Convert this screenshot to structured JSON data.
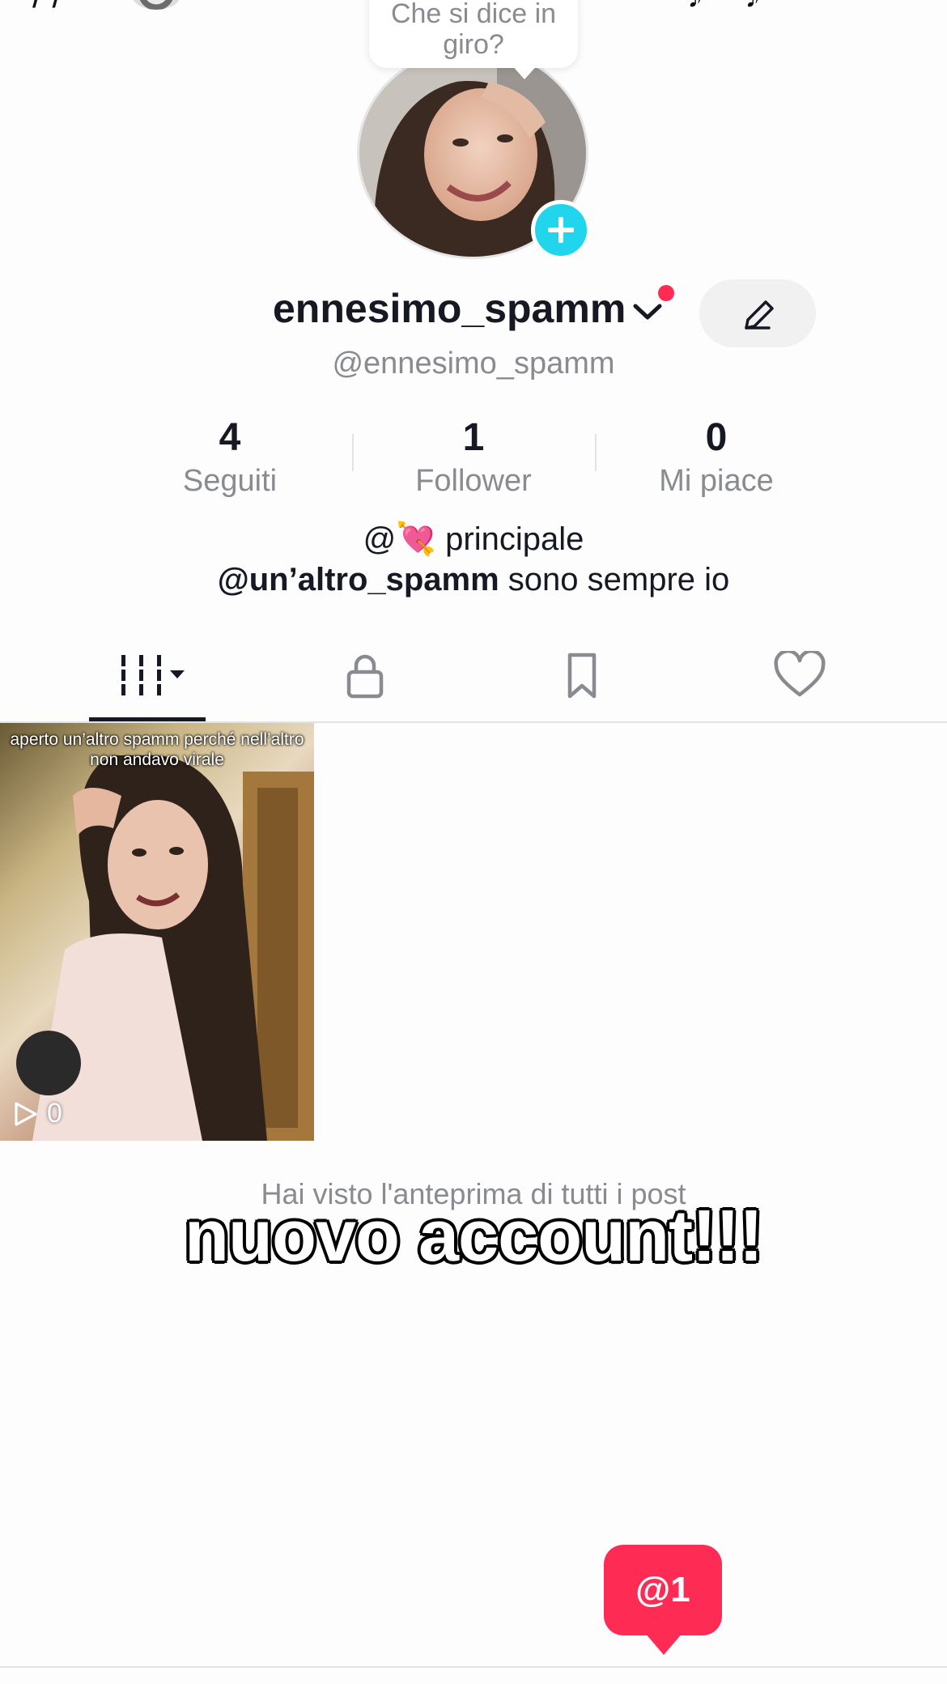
{
  "top_bar": {
    "left_fragment": "/ /",
    "right_fragment": "♪ ♪",
    "icons": [
      "add-friend-icon",
      "mini-avatar",
      "creator-tools-icon",
      "menu-icon"
    ]
  },
  "profile": {
    "bubble_text": "Che si dice in giro?",
    "display_name": "ennesimo_spamm",
    "handle": "@ennesimo_spamm",
    "has_notification_dot": true
  },
  "stats": [
    {
      "value": "4",
      "label": "Seguiti"
    },
    {
      "value": "1",
      "label": "Follower"
    },
    {
      "value": "0",
      "label": "Mi piace"
    }
  ],
  "bio": {
    "line1": "@💘 principale",
    "line2_mention": "@un’altro_spamm",
    "line2_text": " sono sempre io"
  },
  "tabs": [
    {
      "name": "videos",
      "icon": "grid-icon",
      "active": true
    },
    {
      "name": "private",
      "icon": "lock-icon",
      "active": false
    },
    {
      "name": "saved",
      "icon": "bookmark-icon",
      "active": false
    },
    {
      "name": "liked",
      "icon": "heart-icon",
      "active": false
    }
  ],
  "videos": [
    {
      "caption": "aperto un’altro spamm perché nell’altro non andavo virale",
      "views": "0"
    }
  ],
  "end_note": "Hai visto l'anteprima di tutti i post",
  "overlay_title": "nuovo account!!!",
  "mention_badge": {
    "symbol": "@",
    "count": "1"
  },
  "colors": {
    "accent": "#fe2c55",
    "add_button": "#20d5ec",
    "secondary_text": "#8a8b91"
  }
}
